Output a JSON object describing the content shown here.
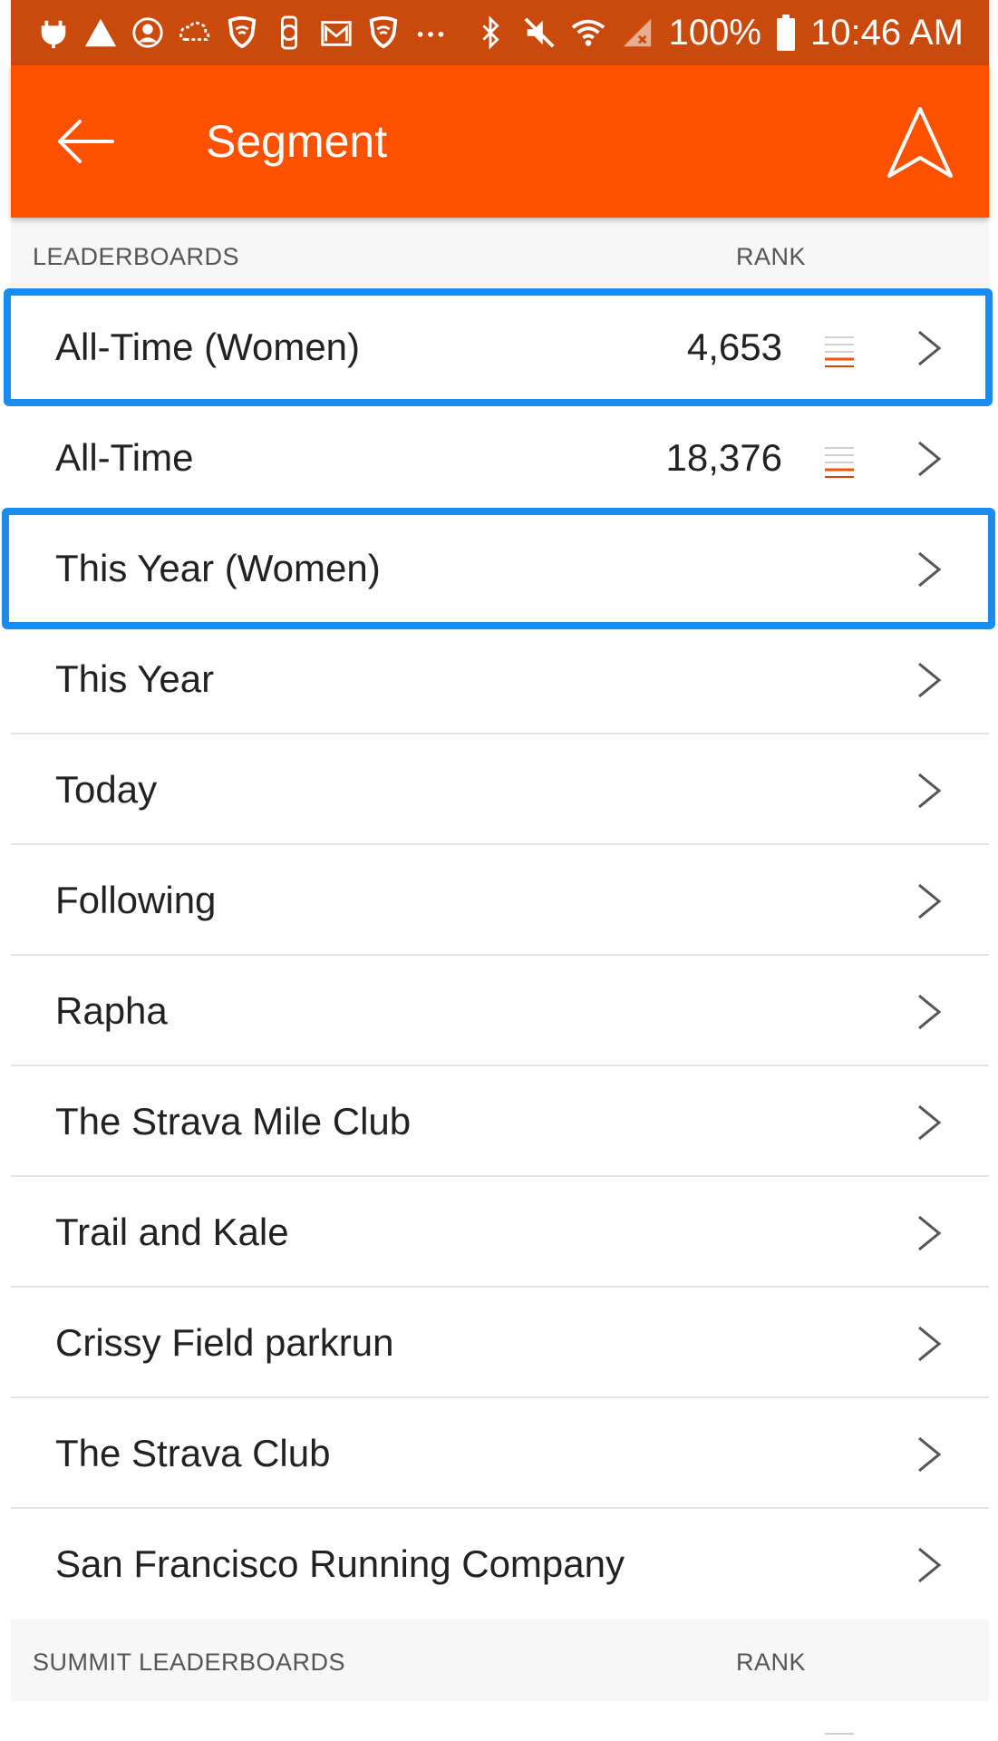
{
  "status_bar": {
    "battery": "100%",
    "time": "10:46 AM",
    "left_icons": [
      "plug-icon",
      "warning-icon",
      "account-icon",
      "cloud-icon",
      "shield-icon",
      "watch-icon",
      "mail-icon",
      "shield-icon",
      "more-dots-icon"
    ],
    "right_icons": [
      "bluetooth-icon",
      "mute-icon",
      "wifi-icon",
      "signal-icon",
      "battery-icon"
    ]
  },
  "app_bar": {
    "title": "Segment"
  },
  "leaderboards": {
    "header_label": "LEADERBOARDS",
    "header_rank": "RANK",
    "items": [
      {
        "label": "All-Time (Women)",
        "rank": "4,653"
      },
      {
        "label": "All-Time",
        "rank": "18,376"
      },
      {
        "label": "This Year (Women)",
        "rank": ""
      },
      {
        "label": "This Year",
        "rank": ""
      },
      {
        "label": "Today",
        "rank": ""
      },
      {
        "label": "Following",
        "rank": ""
      },
      {
        "label": "Rapha",
        "rank": ""
      },
      {
        "label": "The Strava Mile Club",
        "rank": ""
      },
      {
        "label": "Trail and Kale",
        "rank": ""
      },
      {
        "label": "Crissy Field parkrun",
        "rank": ""
      },
      {
        "label": "The Strava Club",
        "rank": ""
      },
      {
        "label": "San Francisco Running Company",
        "rank": ""
      }
    ]
  },
  "summit_leaderboards": {
    "header_label": "SUMMIT LEADERBOARDS",
    "header_rank": "RANK"
  },
  "colors": {
    "brand": "#fc5200",
    "status_bar": "#c94a0c",
    "highlight": "#1a8cf0"
  }
}
